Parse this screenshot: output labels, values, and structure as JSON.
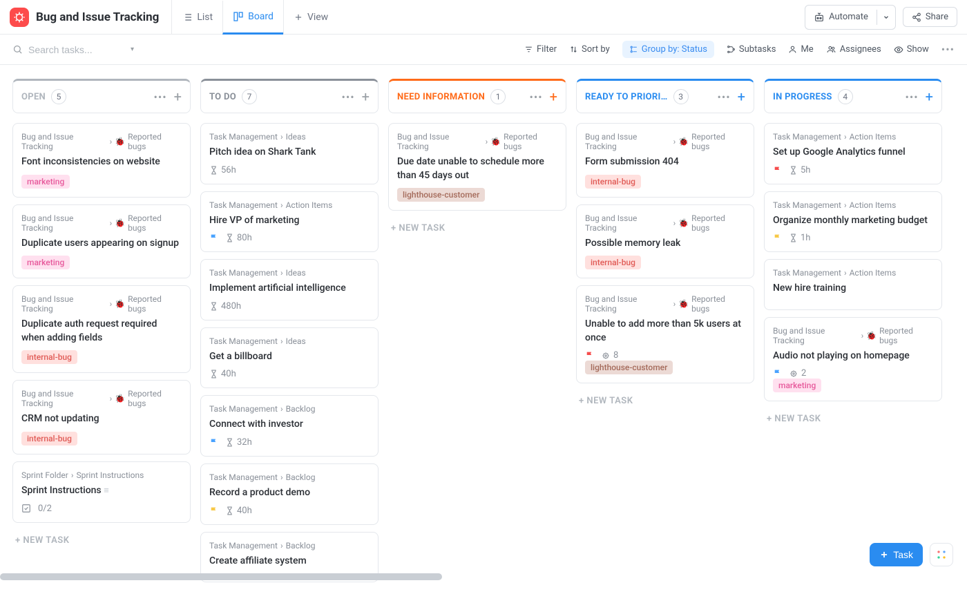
{
  "header": {
    "title": "Bug and Issue Tracking",
    "tabs": {
      "list": "List",
      "board": "Board",
      "view": "View"
    },
    "automate": "Automate",
    "share": "Share"
  },
  "toolbar": {
    "search_placeholder": "Search tasks...",
    "filter": "Filter",
    "sortby": "Sort by",
    "groupby": "Group by: Status",
    "subtasks": "Subtasks",
    "me": "Me",
    "assignees": "Assignees",
    "show": "Show"
  },
  "newtask_label": "+ NEW TASK",
  "columns": [
    {
      "title": "OPEN",
      "count": "5",
      "accent": "#b0b6bd",
      "plus_color": "#9aa0a6",
      "cards": [
        {
          "crumb1": "Bug and Issue Tracking",
          "crumb2": "Reported bugs",
          "bug": true,
          "title": "Font inconsistencies on website",
          "tags": [
            {
              "text": "marketing",
              "cls": "tag-marketing"
            }
          ]
        },
        {
          "crumb1": "Bug and Issue Tracking",
          "crumb2": "Reported bugs",
          "bug": true,
          "title": "Duplicate users appearing on signup",
          "tags": [
            {
              "text": "marketing",
              "cls": "tag-marketing"
            }
          ]
        },
        {
          "crumb1": "Bug and Issue Tracking",
          "crumb2": "Reported bugs",
          "bug": true,
          "title": "Duplicate auth request required when adding fields",
          "tags": [
            {
              "text": "internal-bug",
              "cls": "tag-internal"
            }
          ]
        },
        {
          "crumb1": "Bug and Issue Tracking",
          "crumb2": "Reported bugs",
          "bug": true,
          "title": "CRM not updating",
          "tags": [
            {
              "text": "internal-bug",
              "cls": "tag-internal"
            }
          ]
        },
        {
          "crumb1": "Sprint Folder",
          "crumb2": "Sprint Instructions",
          "bug": false,
          "title": "Sprint Instructions",
          "desc": true,
          "checklist": "0/2"
        }
      ]
    },
    {
      "title": "TO DO",
      "count": "7",
      "accent": "#8a9099",
      "plus_color": "#9aa0a6",
      "cards": [
        {
          "crumb1": "Task Management",
          "crumb2": "Ideas",
          "bug": false,
          "title": "Pitch idea on Shark Tank",
          "meta": [
            {
              "type": "time",
              "text": "56h"
            }
          ]
        },
        {
          "crumb1": "Task Management",
          "crumb2": "Action Items",
          "bug": false,
          "title": "Hire VP of marketing",
          "meta": [
            {
              "type": "flag",
              "color": "blue"
            },
            {
              "type": "time",
              "text": "80h"
            }
          ]
        },
        {
          "crumb1": "Task Management",
          "crumb2": "Ideas",
          "bug": false,
          "title": "Implement artificial intelligence",
          "meta": [
            {
              "type": "time",
              "text": "480h"
            }
          ]
        },
        {
          "crumb1": "Task Management",
          "crumb2": "Ideas",
          "bug": false,
          "title": "Get a billboard",
          "meta": [
            {
              "type": "time",
              "text": "40h"
            }
          ]
        },
        {
          "crumb1": "Task Management",
          "crumb2": "Backlog",
          "bug": false,
          "title": "Connect with investor",
          "meta": [
            {
              "type": "flag",
              "color": "blue"
            },
            {
              "type": "time",
              "text": "32h"
            }
          ]
        },
        {
          "crumb1": "Task Management",
          "crumb2": "Backlog",
          "bug": false,
          "title": "Record a product demo",
          "meta": [
            {
              "type": "flag",
              "color": "yellow"
            },
            {
              "type": "time",
              "text": "40h"
            }
          ]
        },
        {
          "crumb1": "Task Management",
          "crumb2": "Backlog",
          "bug": false,
          "title": "Create affiliate system"
        }
      ]
    },
    {
      "title": "NEED INFORMATION",
      "count": "1",
      "accent": "#ff6b1a",
      "plus_color": "#ff6b1a",
      "cards": [
        {
          "crumb1": "Bug and Issue Tracking",
          "crumb2": "Reported bugs",
          "bug": true,
          "title": "Due date unable to schedule more than 45 days out",
          "tags": [
            {
              "text": "lighthouse-customer",
              "cls": "tag-lighthouse"
            }
          ]
        }
      ]
    },
    {
      "title": "READY TO PRIORI…",
      "count": "3",
      "accent": "#2a8cf0",
      "plus_color": "#2a8cf0",
      "cards": [
        {
          "crumb1": "Bug and Issue Tracking",
          "crumb2": "Reported bugs",
          "bug": true,
          "title": "Form submission 404",
          "tags": [
            {
              "text": "internal-bug",
              "cls": "tag-internal"
            }
          ]
        },
        {
          "crumb1": "Bug and Issue Tracking",
          "crumb2": "Reported bugs",
          "bug": true,
          "title": "Possible memory leak",
          "tags": [
            {
              "text": "internal-bug",
              "cls": "tag-internal"
            }
          ]
        },
        {
          "crumb1": "Bug and Issue Tracking",
          "crumb2": "Reported bugs",
          "bug": true,
          "title": "Unable to add more than 5k users at once",
          "meta": [
            {
              "type": "flag",
              "color": "red"
            },
            {
              "type": "gear",
              "text": "8"
            }
          ],
          "tags": [
            {
              "text": "lighthouse-customer",
              "cls": "tag-lighthouse"
            }
          ]
        }
      ]
    },
    {
      "title": "IN PROGRESS",
      "count": "4",
      "accent": "#2a8cf0",
      "plus_color": "#2a8cf0",
      "cards": [
        {
          "crumb1": "Task Management",
          "crumb2": "Action Items",
          "bug": false,
          "title": "Set up Google Analytics funnel",
          "meta": [
            {
              "type": "flag",
              "color": "red"
            },
            {
              "type": "time",
              "text": "5h"
            }
          ]
        },
        {
          "crumb1": "Task Management",
          "crumb2": "Action Items",
          "bug": false,
          "title": "Organize monthly marketing budget",
          "meta": [
            {
              "type": "flag",
              "color": "yellow"
            },
            {
              "type": "time",
              "text": "1h"
            }
          ]
        },
        {
          "crumb1": "Task Management",
          "crumb2": "Action Items",
          "bug": false,
          "title": "New hire training"
        },
        {
          "crumb1": "Bug and Issue Tracking",
          "crumb2": "Reported bugs",
          "bug": true,
          "title": "Audio not playing on homepage",
          "meta": [
            {
              "type": "flag",
              "color": "blue"
            },
            {
              "type": "gear",
              "text": "2"
            }
          ],
          "tags": [
            {
              "text": "marketing",
              "cls": "tag-marketing"
            }
          ]
        }
      ]
    }
  ],
  "fab": {
    "task": "Task"
  }
}
